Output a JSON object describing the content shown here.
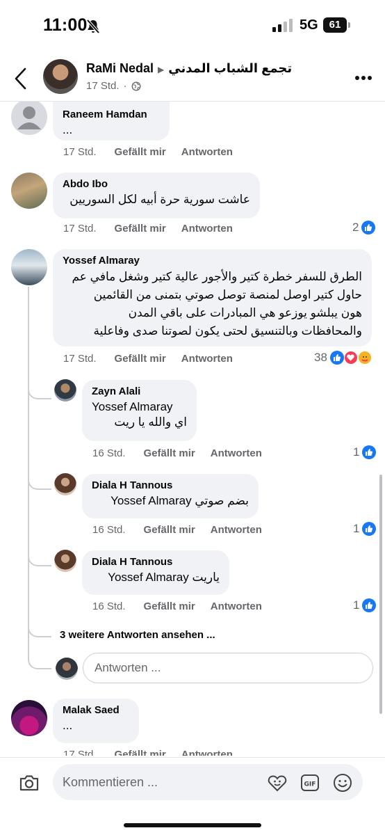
{
  "status": {
    "time": "11:00",
    "network": "5G",
    "battery": "61"
  },
  "header": {
    "author": "RaMi Nedal",
    "group": "تجمع الشباب المدني",
    "time": "17 Std.",
    "separator": "·"
  },
  "actions": {
    "like": "Gefällt mir",
    "reply": "Antworten"
  },
  "comments": [
    {
      "name": "Raneem Hamdan",
      "text": "...",
      "time": "17 Std."
    },
    {
      "name": "Abdo Ibo",
      "text": "عاشت سورية حرة أبيه لكل السوريين",
      "time": "17 Std.",
      "reactions": "2"
    },
    {
      "name": "Yossef Almaray",
      "lines": [
        "الطرق للسفر خطرة كتير والأجور عالية كتير وشغل مافي عم",
        "حاول كتير اوصل لمنصة توصل صوتي بتمنى من القائمين",
        "هون يبلشو يوزعو هي المبادرات على باقي المدن",
        "والمحافظات وبالتنسيق لحتى يكون لصوتنا صدى وفاعلية"
      ],
      "time": "17 Std.",
      "reactions": "38",
      "replies": [
        {
          "name": "Zayn Alali",
          "mention": "Yossef Almaray",
          "text": "اي والله يا ريت",
          "time": "16 Std.",
          "reactions": "1"
        },
        {
          "name": "Diala H Tannous",
          "mention": "Yossef Almaray",
          "text": "بضم صوتي",
          "time": "16 Std.",
          "reactions": "1"
        },
        {
          "name": "Diala H Tannous",
          "mention": "Yossef Almaray",
          "text": "ياريت",
          "time": "16 Std.",
          "reactions": "1"
        }
      ],
      "see_more": "3 weitere Antworten ansehen ...",
      "reply_placeholder": "Antworten ..."
    },
    {
      "name": "Malak Saed",
      "text": "...",
      "time": "17 Std."
    }
  ],
  "composer": {
    "placeholder": "Kommentieren ..."
  }
}
